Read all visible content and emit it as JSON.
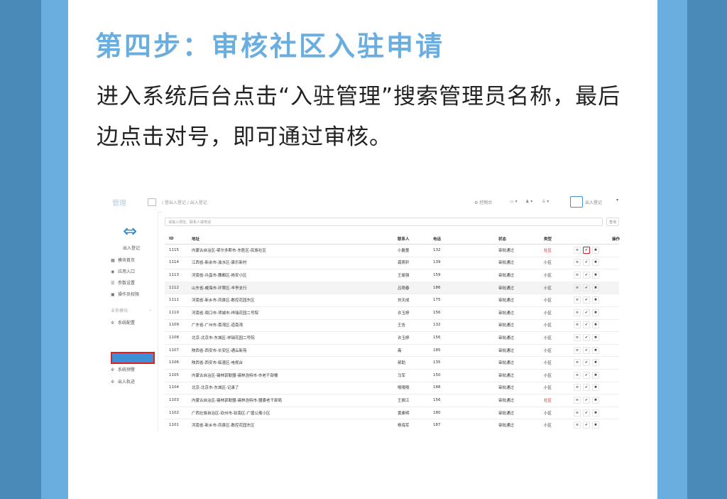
{
  "heading": "第四步：审核社区入驻申请",
  "description": "进入系统后台点击“入驻管理”搜索管理员名称，最后边点击对号，即可通过审核。",
  "screenshot": {
    "brand": "管理",
    "breadcrumb": "/  登出入登记 / 出入登记",
    "topbar": {
      "console": "控制台",
      "calendar": "▭ ▾",
      "bell": "♟ ▾",
      "user": "♙ ▾",
      "app_name": "出入登记",
      "caret": "▾"
    },
    "sidebar": {
      "logo_label": "出入登记",
      "items": [
        {
          "icon": "▦",
          "label": "模块首页"
        },
        {
          "icon": "◉",
          "label": "应用入口"
        },
        {
          "icon": "☰",
          "label": "参数设置"
        },
        {
          "icon": "▣",
          "label": "操作员权限"
        }
      ],
      "group_label": "业务模块",
      "group_caret": "⌄",
      "group_items": [
        {
          "icon": "✲",
          "label": "系统配置"
        },
        {
          "icon": "✲",
          "label": "系统预警"
        },
        {
          "icon": "✲",
          "label": "出入轨迹"
        }
      ]
    },
    "search": {
      "placeholder": "请输入地址、联系人或电话",
      "button": "查询"
    },
    "table": {
      "headers": [
        "ID",
        "地址",
        "联系人",
        "电话",
        "状态",
        "类型",
        "操作"
      ],
      "rows": [
        {
          "id": "1115",
          "addr": "内蒙古自治区-鄂尔多斯市-东胜区-民族社区",
          "contact": "小磊童",
          "phone": "132",
          "status": "审批通过",
          "type": "社区",
          "type_red": true
        },
        {
          "id": "1114",
          "addr": "江西省-新余市-渝水区-康乐新村",
          "contact": "龚燕轩",
          "phone": "139",
          "status": "审批通过",
          "type": "小区",
          "type_red": false
        },
        {
          "id": "1113",
          "addr": "河南省-许昌市-魏都区-祐安小区",
          "contact": "王瑜强",
          "phone": "159",
          "status": "审批通过",
          "type": "小区",
          "type_red": false
        },
        {
          "id": "1112",
          "addr": "山东省-威海市-环翠区-羊亭支行",
          "contact": "吕艳春",
          "phone": "186",
          "status": "审批通过",
          "type": "小区",
          "type_red": false
        },
        {
          "id": "1111",
          "addr": "河南省-新乡市-凤泉区-数控花园东区",
          "contact": "刘天成",
          "phone": "175",
          "status": "审批通过",
          "type": "小区",
          "type_red": false
        },
        {
          "id": "1110",
          "addr": "河南省-周口市-项城市-祥瑞花园二号院",
          "contact": "许玉婷",
          "phone": "156",
          "status": "审批通过",
          "type": "小区",
          "type_red": false
        },
        {
          "id": "1109",
          "addr": "广东省-广州市-荔湾区-道南湾",
          "contact": "王告",
          "phone": "132",
          "status": "审批通过",
          "type": "小区",
          "type_red": false
        },
        {
          "id": "1108",
          "addr": "北京-北京市-东城区-祥瑞花园二号院",
          "contact": "许玉婷",
          "phone": "156",
          "status": "审批通过",
          "type": "小区",
          "type_red": false
        },
        {
          "id": "1107",
          "addr": "陕西省-西安市-长安区-通云新苑",
          "contact": "斋",
          "phone": "185",
          "status": "审批通过",
          "type": "小区",
          "type_red": false
        },
        {
          "id": "1106",
          "addr": "陕西省-西安市-临潼区-电视台",
          "contact": "郝助",
          "phone": "135",
          "status": "审批通过",
          "type": "小区",
          "type_red": false
        },
        {
          "id": "1105",
          "addr": "内蒙古自治区-锡林郭勒盟-锡林浩特市-市老干部楼",
          "contact": "马军",
          "phone": "150",
          "status": "审批通过",
          "type": "小区",
          "type_red": false
        },
        {
          "id": "1104",
          "addr": "北京-北京市-东城区-记录了",
          "contact": "哦哦哦",
          "phone": "188",
          "status": "审批通过",
          "type": "小区",
          "type_red": false
        },
        {
          "id": "1103",
          "addr": "内蒙古自治区-锡林郭勒盟-锡林浩特市-盟委老干部局",
          "contact": "王振江",
          "phone": "156",
          "status": "审批通过",
          "type": "社区",
          "type_red": true
        },
        {
          "id": "1102",
          "addr": "广西壮族自治区-钦州市-钦南区-广盛公寓小区",
          "contact": "黄素明",
          "phone": "180",
          "status": "审批通过",
          "type": "小区",
          "type_red": false
        },
        {
          "id": "1101",
          "addr": "河南省-新乡市-凤泉区-数控花园东区",
          "contact": "杨海军",
          "phone": "187",
          "status": "审批通过",
          "type": "小区",
          "type_red": false
        }
      ],
      "ops": {
        "list": "≡",
        "approve": "✔",
        "reject": "✖"
      }
    }
  }
}
